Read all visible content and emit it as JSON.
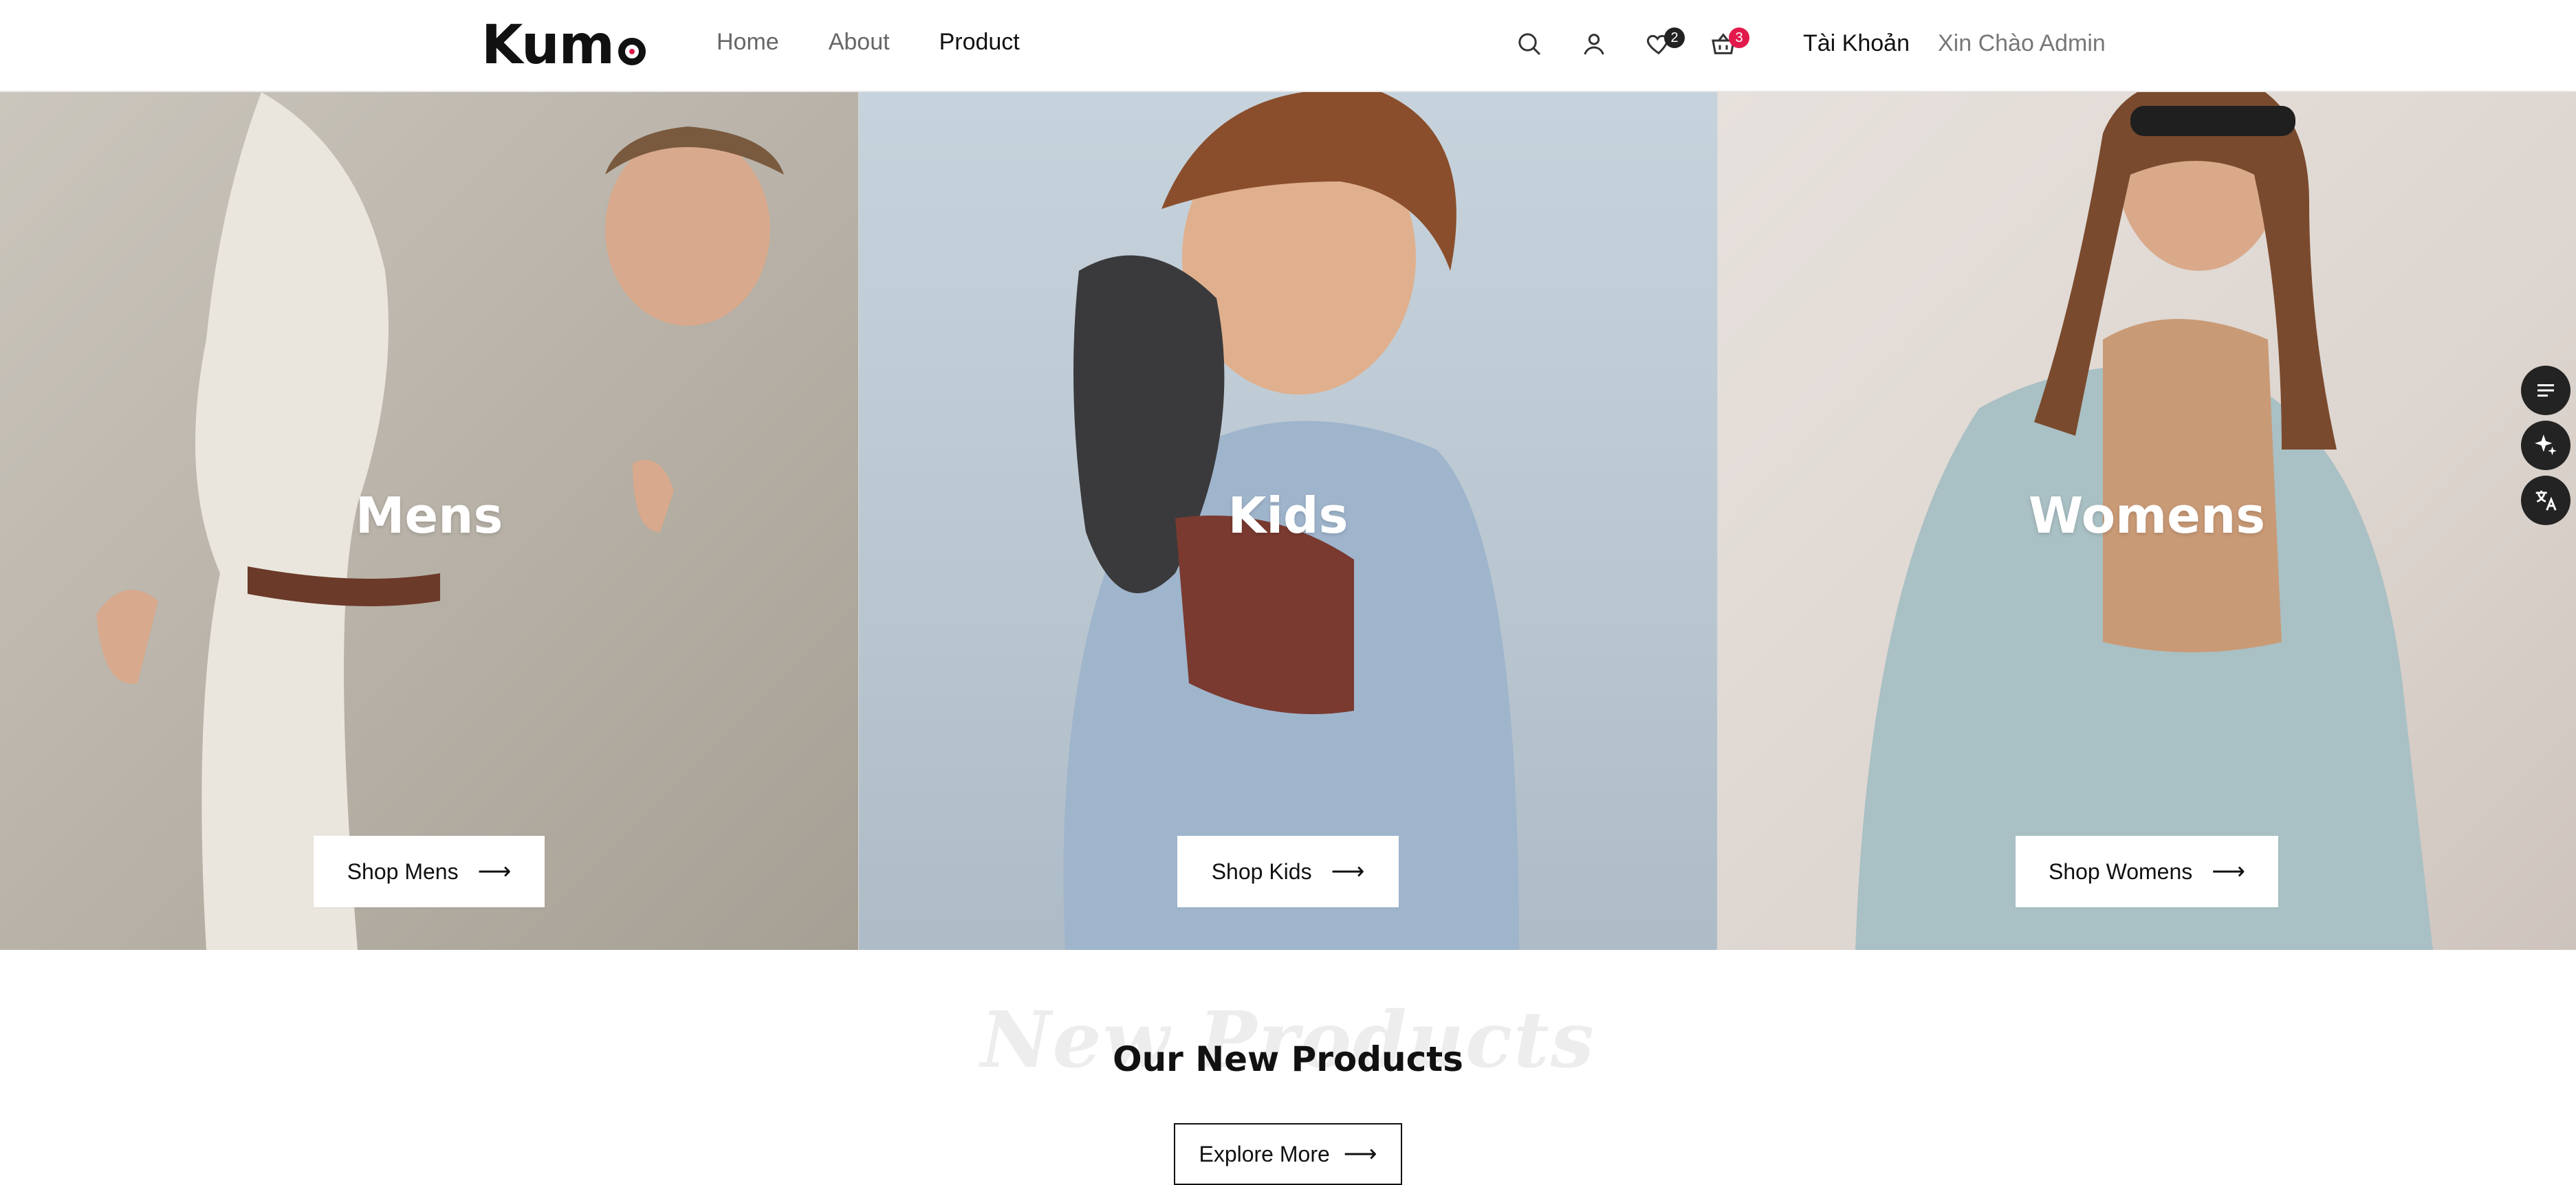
{
  "brand": {
    "name": "Kum",
    "accent": "#e21a4b"
  },
  "nav": {
    "items": [
      "Home",
      "About",
      "Product"
    ]
  },
  "header": {
    "icons": [
      "search-icon",
      "user-icon",
      "heart-icon",
      "cart-icon"
    ],
    "wishlist_count": "2",
    "cart_count": "3",
    "account": "Tài Khoản",
    "greeting": "Xin Chào Admin"
  },
  "hero": {
    "panels": [
      {
        "title": "Mens",
        "button": "Shop Mens"
      },
      {
        "title": "Kids",
        "button": "Shop Kids"
      },
      {
        "title": "Womens",
        "button": "Shop Womens"
      }
    ]
  },
  "side_tools": [
    "list-icon",
    "sparkle-icon",
    "translate-icon"
  ],
  "section": {
    "watermark": "New Products",
    "title": "Our New Products",
    "explore": "Explore More"
  }
}
